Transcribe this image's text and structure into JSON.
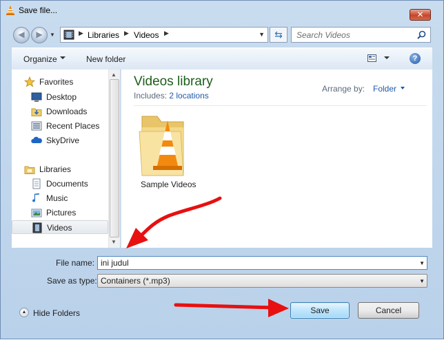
{
  "window": {
    "title": "Save file..."
  },
  "address": {
    "crumbs": [
      "Libraries",
      "Videos"
    ],
    "search_placeholder": "Search Videos"
  },
  "toolbar": {
    "organize_label": "Organize",
    "new_folder_label": "New folder"
  },
  "nav": {
    "favorites_label": "Favorites",
    "favorites": [
      "Desktop",
      "Downloads",
      "Recent Places",
      "SkyDrive"
    ],
    "libraries_label": "Libraries",
    "libraries": [
      "Documents",
      "Music",
      "Pictures",
      "Videos"
    ],
    "selected": "Videos"
  },
  "content": {
    "title": "Videos library",
    "includes_label": "Includes:",
    "includes_link": "2 locations",
    "arrange_label": "Arrange by:",
    "arrange_value": "Folder",
    "items": [
      {
        "label": "Sample Videos",
        "icon": "vlc-folder-icon"
      }
    ]
  },
  "form": {
    "filename_label": "File name:",
    "filename_value": "ini judul",
    "type_label": "Save as type:",
    "type_value": "Containers (*.mp3)"
  },
  "footer": {
    "hide_folders_label": "Hide Folders",
    "save_label": "Save",
    "cancel_label": "Cancel"
  },
  "colors": {
    "annotation_arrow": "#e81010",
    "library_title": "#1e5d1a",
    "link": "#1e5aa8"
  }
}
